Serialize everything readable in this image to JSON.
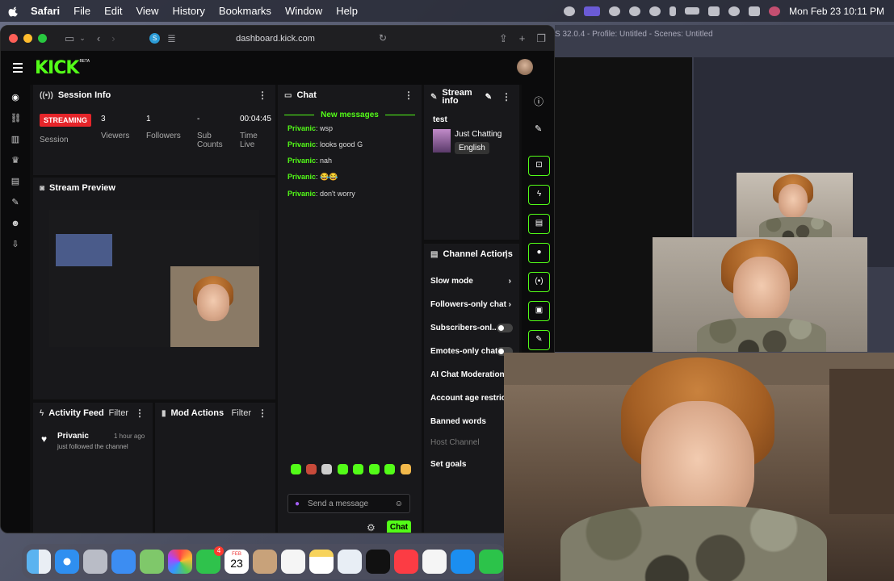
{
  "menubar": {
    "app": "Safari",
    "items": [
      "File",
      "Edit",
      "View",
      "History",
      "Bookmarks",
      "Window",
      "Help"
    ],
    "datetime": "Mon Feb 23  10:11 PM",
    "icons": [
      "obs-icon",
      "screen-icon",
      "moon-icon",
      "color-icon",
      "play-icon",
      "bluetooth-icon",
      "battery-icon",
      "wifi-icon",
      "search-icon",
      "control-center-icon",
      "siri-icon"
    ]
  },
  "browser": {
    "url": "dashboard.kick.com",
    "favicon_letter": "S"
  },
  "header": {
    "logo": "KICK",
    "beta": "BETA"
  },
  "session": {
    "title": "Session Info",
    "badge": "STREAMING",
    "badge_label": "Session",
    "viewers_value": "3",
    "viewers_label": "Viewers",
    "followers_value": "1",
    "followers_label": "Followers",
    "subs_value": "-",
    "subs_label": "Sub Counts",
    "time_value": "00:04:45",
    "time_label": "Time Live"
  },
  "preview": {
    "title": "Stream Preview"
  },
  "activity": {
    "title": "Activity Feed",
    "filter": "Filter",
    "item_user": "Privanic",
    "item_time": "1 hour ago",
    "item_text": "just followed the channel"
  },
  "mod": {
    "title": "Mod Actions",
    "filter": "Filter"
  },
  "chat": {
    "title": "Chat",
    "new_messages": "New messages",
    "messages": [
      {
        "user": "Privanic",
        "text": ": wsp"
      },
      {
        "user": "Privanic",
        "text": ": looks good G"
      },
      {
        "user": "Privanic",
        "text": ": nah"
      },
      {
        "user": "Privanic",
        "text": ": 😂😂"
      },
      {
        "user": "Privanic",
        "text": ": don't worry"
      }
    ],
    "placeholder": "Send a message",
    "send": "Chat"
  },
  "stream_info": {
    "title": "Stream info",
    "stream_title": "test",
    "category": "Just Chatting",
    "language": "English"
  },
  "channel_actions": {
    "title": "Channel Actions",
    "items": [
      "Slow mode",
      "Followers-only chat",
      "Subscribers-onl...",
      "Emotes-only chat",
      "AI Chat Moderation",
      "Account age restricti",
      "Banned words",
      "Host Channel",
      "Set goals"
    ]
  },
  "mirror": {
    "title": "S 32.0.4 - Profile: Untitled - Scenes: Untitled"
  },
  "dock": {
    "calendar_month": "FEB",
    "calendar_day": "23",
    "messages_badge": "4"
  }
}
